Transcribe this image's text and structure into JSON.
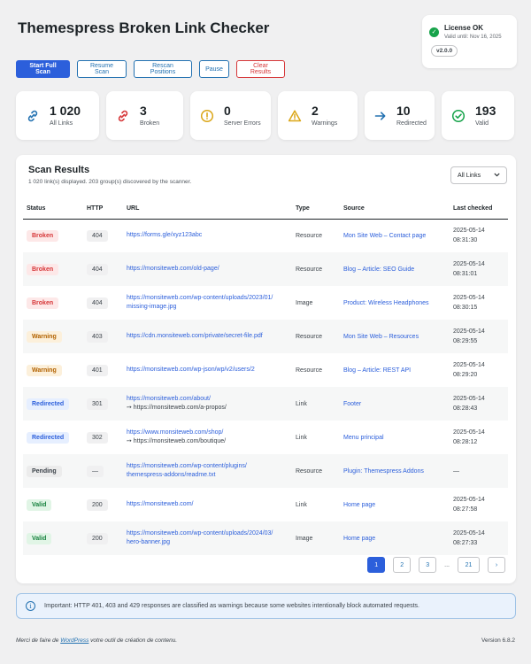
{
  "app": {
    "title": "Themespress Broken Link Checker"
  },
  "license": {
    "status": "License OK",
    "valid_until": "Valid until: Nov 16, 2025",
    "version": "v2.0.0"
  },
  "toolbar": {
    "start_full_scan": "Start Full Scan",
    "resume_scan": "Resume Scan",
    "rescan_positions": "Rescan Positions",
    "pause": "Pause",
    "clear_results": "Clear Results"
  },
  "stats": [
    {
      "value": "1 020",
      "label": "All Links",
      "icon": "link-icon",
      "color": "#2271b1"
    },
    {
      "value": "3",
      "label": "Broken",
      "icon": "broken-link-icon",
      "color": "#d63638"
    },
    {
      "value": "0",
      "label": "Server Errors",
      "icon": "alert-circle-icon",
      "color": "#dba617"
    },
    {
      "value": "2",
      "label": "Warnings",
      "icon": "warning-triangle-icon",
      "color": "#dba617"
    },
    {
      "value": "10",
      "label": "Redirected",
      "icon": "arrow-right-icon",
      "color": "#2271b1"
    },
    {
      "value": "193",
      "label": "Valid",
      "icon": "check-circle-icon",
      "color": "#16a34a"
    }
  ],
  "results": {
    "title": "Scan Results",
    "subtitle": "1 020 link(s) displayed. 203 group(s) discovered by the scanner.",
    "filter": "All Links",
    "columns": [
      "Status",
      "HTTP",
      "URL",
      "Type",
      "Source",
      "Last checked"
    ],
    "rows": [
      {
        "status": "Broken",
        "http": "404",
        "url": [
          "https://forms.gle/xyz123abc"
        ],
        "type": "Resource",
        "source": "Mon Site Web – Contact page",
        "checked": [
          "2025-05-14",
          "08:31:30"
        ]
      },
      {
        "status": "Broken",
        "http": "404",
        "url": [
          "https://monsiteweb.com/old-page/"
        ],
        "type": "Resource",
        "source": "Blog – Article: SEO Guide",
        "checked": [
          "2025-05-14",
          "08:31:01"
        ]
      },
      {
        "status": "Broken",
        "http": "404",
        "url": [
          "https://monsiteweb.com/wp-content/uploads/2023/01/",
          "missing-image.jpg"
        ],
        "type": "Image",
        "source": "Product: Wireless Headphones",
        "checked": [
          "2025-05-14",
          "08:30:15"
        ]
      },
      {
        "status": "Warning",
        "http": "403",
        "url": [
          "https://cdn.monsiteweb.com/private/secret-file.pdf"
        ],
        "type": "Resource",
        "source": "Mon Site Web – Resources",
        "checked": [
          "2025-05-14",
          "08:29:55"
        ]
      },
      {
        "status": "Warning",
        "http": "401",
        "url": [
          "https://monsiteweb.com/wp-json/wp/v2/users/2"
        ],
        "type": "Resource",
        "source": "Blog – Article: REST API",
        "checked": [
          "2025-05-14",
          "08:29:20"
        ]
      },
      {
        "status": "Redirected",
        "http": "301",
        "url": [
          "https://monsiteweb.com/about/"
        ],
        "redirect": "➙  https://monsiteweb.com/a-propos/",
        "type": "Link",
        "source": "Footer",
        "checked": [
          "2025-05-14",
          "08:28:43"
        ]
      },
      {
        "status": "Redirected",
        "http": "302",
        "url": [
          "https://www.monsiteweb.com/shop/"
        ],
        "redirect": "➙  https://monsiteweb.com/boutique/",
        "type": "Link",
        "source": "Menu principal",
        "checked": [
          "2025-05-14",
          "08:28:12"
        ]
      },
      {
        "status": "Pending",
        "http": "—",
        "url": [
          "https://monsiteweb.com/wp-content/plugins/",
          "themespress-addons/readme.txt"
        ],
        "type": "Resource",
        "source": "Plugin: Themespress Addons",
        "checked": [
          "—"
        ]
      },
      {
        "status": "Valid",
        "http": "200",
        "url": [
          "https://monsiteweb.com/"
        ],
        "type": "Link",
        "source": "Home page",
        "checked": [
          "2025-05-14",
          "08:27:58"
        ]
      },
      {
        "status": "Valid",
        "http": "200",
        "url": [
          "https://monsiteweb.com/wp-content/uploads/2024/03/",
          "hero-banner.jpg"
        ],
        "type": "Image",
        "source": "Home page",
        "checked": [
          "2025-05-14",
          "08:27:33"
        ]
      }
    ]
  },
  "pagination": {
    "pages": [
      "1",
      "2",
      "3"
    ],
    "ellipsis": "...",
    "last": "21",
    "next": "›",
    "current": "1"
  },
  "notice": {
    "text": "Important: HTTP 401, 403 and 429 responses are classified as warnings because some websites intentionally block automated requests."
  },
  "footer": {
    "prefix": "Merci de faire de ",
    "link": "WordPress",
    "suffix": " votre outil de création de contenu.",
    "version": "Version 6.8.2"
  }
}
